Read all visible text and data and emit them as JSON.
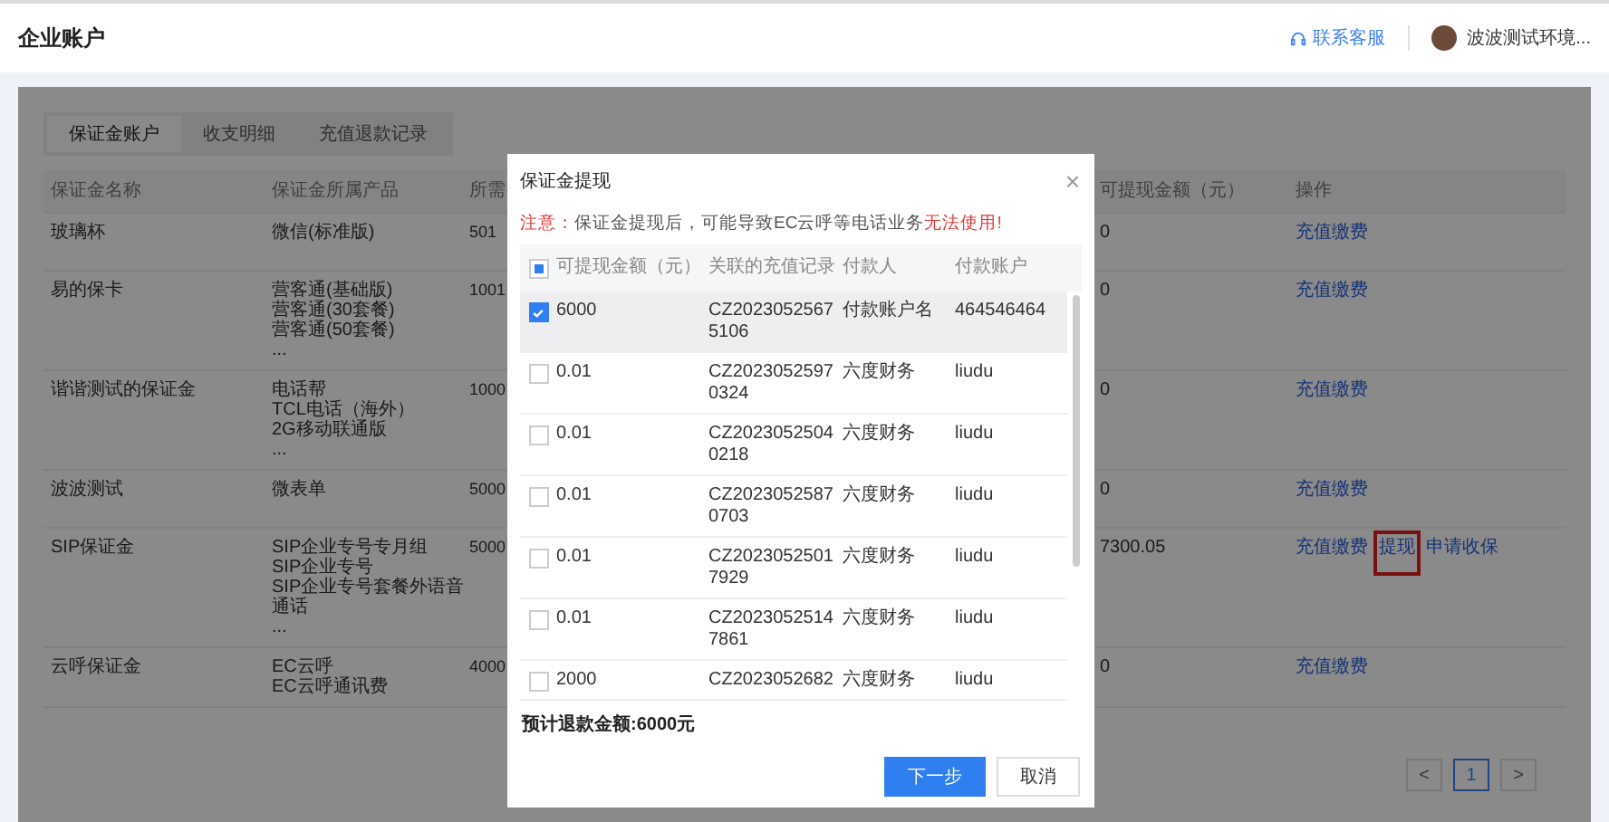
{
  "header": {
    "title": "企业账户",
    "support_link": "联系客服",
    "user_name": "波波测试环境..."
  },
  "tabs": [
    {
      "label": "保证金账户",
      "selected": true
    },
    {
      "label": "收支明细",
      "selected": false
    },
    {
      "label": "充值退款记录",
      "selected": false
    }
  ],
  "table": {
    "columns": [
      "保证金名称",
      "保证金所属产品",
      "所需",
      "可提现金额（元）",
      "操作"
    ],
    "rows": [
      {
        "name": "玻璃杯",
        "products": [
          "微信(标准版)"
        ],
        "column_3": "501",
        "available": "0",
        "actions": [
          {
            "label": "充值缴费",
            "highlighted": false
          }
        ]
      },
      {
        "name": "易的保卡",
        "products": [
          "营客通(基础版)",
          "营客通(30套餐)",
          "营客通(50套餐)",
          "..."
        ],
        "column_3": "1001",
        "available": "0",
        "actions": [
          {
            "label": "充值缴费",
            "highlighted": false
          }
        ]
      },
      {
        "name": "谐谐测试的保证金",
        "products": [
          "电话帮",
          "TCL电话（海外）",
          "2G移动联通版",
          "..."
        ],
        "column_3": "1000",
        "available": "0",
        "actions": [
          {
            "label": "充值缴费",
            "highlighted": false
          }
        ]
      },
      {
        "name": "波波测试",
        "products": [
          "微表单"
        ],
        "column_3": "5000",
        "available": "0",
        "actions": [
          {
            "label": "充值缴费",
            "highlighted": false
          }
        ]
      },
      {
        "name": "SIP保证金",
        "products": [
          "SIP企业专号专月组",
          "SIP企业专号",
          "SIP企业专号套餐外语音通话",
          "..."
        ],
        "column_3": "5000",
        "available": "7300.05",
        "actions": [
          {
            "label": "充值缴费",
            "highlighted": false
          },
          {
            "label": "提现",
            "highlighted": true
          },
          {
            "label": "申请收保",
            "highlighted": false
          }
        ]
      },
      {
        "name": "云呼保证金",
        "products": [
          "EC云呼",
          "EC云呼通讯费"
        ],
        "column_3": "4000",
        "available": "0",
        "actions": [
          {
            "label": "充值缴费",
            "highlighted": false
          }
        ]
      }
    ]
  },
  "pagination": {
    "prev": "<",
    "pages": [
      {
        "label": "1",
        "selected": true
      }
    ],
    "next": ">"
  },
  "dialog": {
    "title": "保证金提现",
    "close": "×",
    "notice": {
      "label": "注意：",
      "text": "保证金提现后，可能导致EC云呼等电话业务",
      "warning": "无法使用!"
    },
    "select_all_indeterminate": true,
    "columns": [
      "可提现金额（元）",
      "关联的充值记录",
      "付款人",
      "付款账户"
    ],
    "rows": [
      {
        "amount": "6000",
        "record": [
          "CZ2023052567",
          "5106"
        ],
        "payer": "付款账户名",
        "account": "464546464",
        "checked": true
      },
      {
        "amount": "0.01",
        "record": [
          "CZ2023052597",
          "0324"
        ],
        "payer": "六度财务",
        "account": "liudu",
        "checked": false
      },
      {
        "amount": "0.01",
        "record": [
          "CZ2023052504",
          "0218"
        ],
        "payer": "六度财务",
        "account": "liudu",
        "checked": false
      },
      {
        "amount": "0.01",
        "record": [
          "CZ2023052587",
          "0703"
        ],
        "payer": "六度财务",
        "account": "liudu",
        "checked": false
      },
      {
        "amount": "0.01",
        "record": [
          "CZ2023052501",
          "7929"
        ],
        "payer": "六度财务",
        "account": "liudu",
        "checked": false
      },
      {
        "amount": "0.01",
        "record": [
          "CZ2023052514",
          "7861"
        ],
        "payer": "六度财务",
        "account": "liudu",
        "checked": false
      },
      {
        "amount": "2000",
        "record": [
          "CZ2023052682"
        ],
        "payer": "六度财务",
        "account": "liudu",
        "checked": false
      }
    ],
    "total": "预计退款金额:6000元",
    "buttons": [
      {
        "label": "下一步",
        "kind": "primary"
      },
      {
        "label": "取消",
        "kind": "default"
      }
    ]
  }
}
